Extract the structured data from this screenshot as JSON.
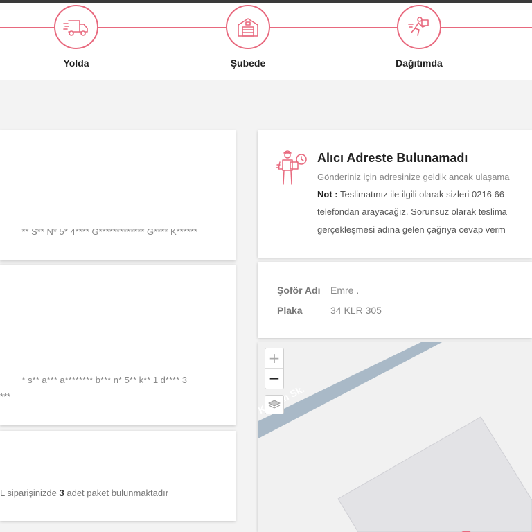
{
  "steps": [
    {
      "label": "Yolda",
      "icon": "truck-icon"
    },
    {
      "label": "Şubede",
      "icon": "warehouse-icon"
    },
    {
      "label": "Dağıtımda",
      "icon": "courier-running-icon"
    }
  ],
  "left_cards": {
    "card1_text": "** S** N* 5* 4**** G************* G**** K******",
    "card2_line1": "* s** a*** a******** b*** n* 5** k** 1 d**** 3",
    "card2_line2": "***",
    "card3_text_pre": "L siparişinizde ",
    "card3_count": "3",
    "card3_text_post": " adet paket bulunmaktadır"
  },
  "status": {
    "icon": "courier-with-box-icon",
    "title": "Alıcı Adreste Bulunamadı",
    "line1": "Gönderiniz için adresinize geldik ancak ulaşama",
    "note_label": "Not :",
    "note_line1": " Teslimatınız ile ilgili olarak sizleri 0216 66",
    "note_line2": "telefondan arayacağız. Sorunsuz olarak teslima",
    "note_line3": "gerçekleşmesi adına gelen çağrıya cevap verm"
  },
  "driver": {
    "name_label": "Şoför Adı",
    "name_value": "Emre .",
    "plate_label": "Plaka",
    "plate_value": "34 KLR 305"
  },
  "map": {
    "street_label": "Kaptan Sk.",
    "zoom_in": "+",
    "zoom_out": "−",
    "layers_icon": "layers-icon",
    "marker_icon": "map-pin-icon"
  },
  "colors": {
    "accent": "#e8697e",
    "road": "#a9b9c7"
  }
}
